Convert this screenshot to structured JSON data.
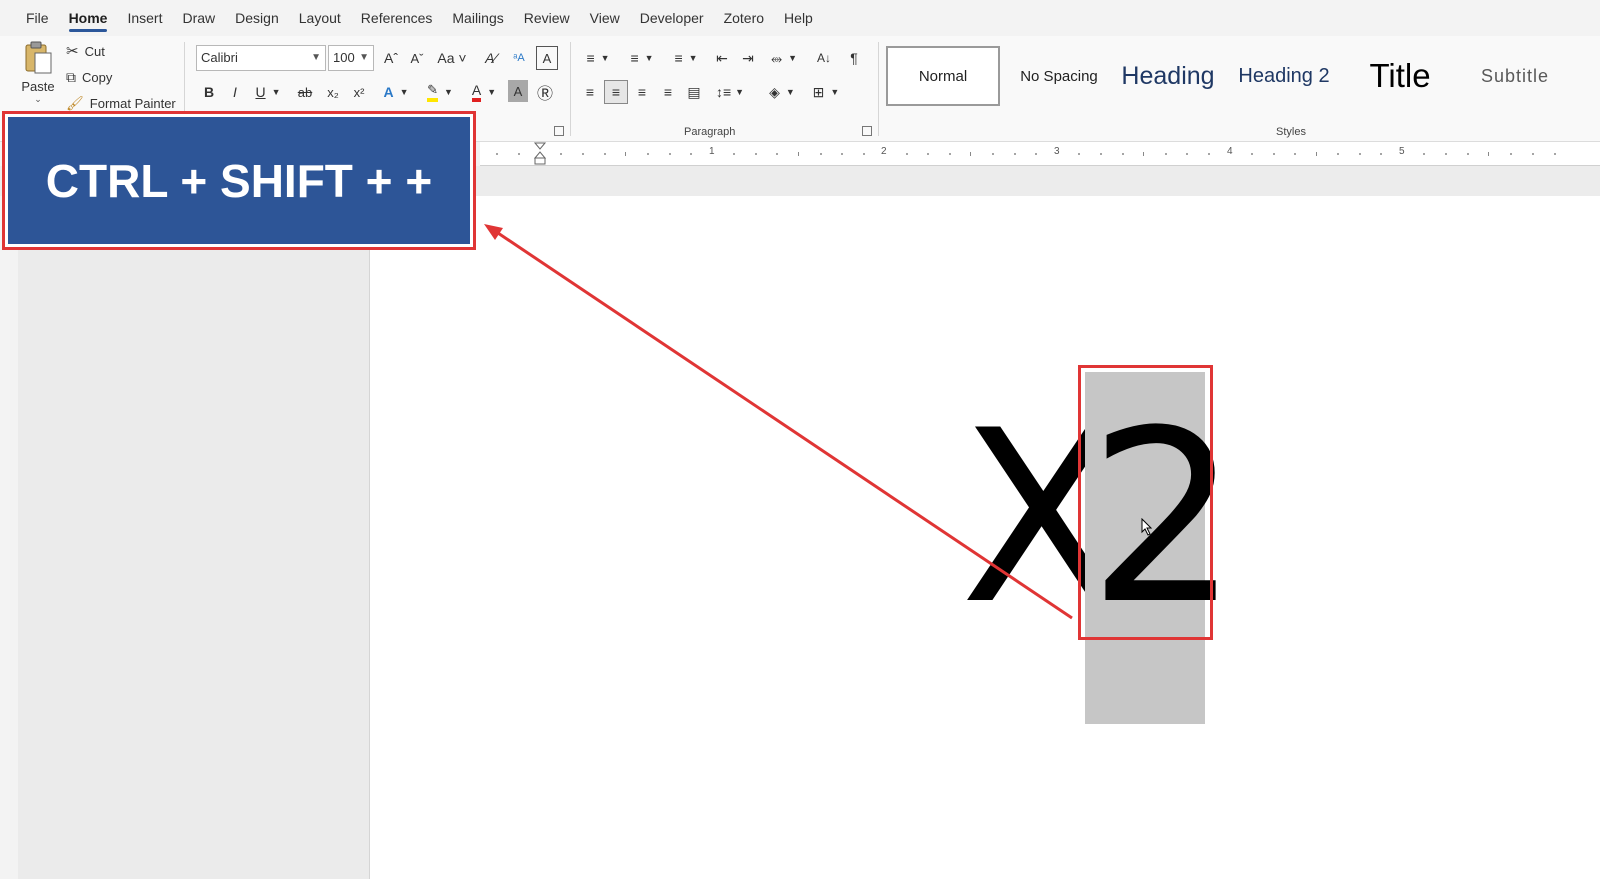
{
  "menu": {
    "tabs": [
      "File",
      "Home",
      "Insert",
      "Draw",
      "Design",
      "Layout",
      "References",
      "Mailings",
      "Review",
      "View",
      "Developer",
      "Zotero",
      "Help"
    ],
    "active": "Home"
  },
  "clipboard": {
    "paste_label": "Paste",
    "cut_label": "Cut",
    "copy_label": "Copy",
    "format_painter_label": "Format Painter"
  },
  "font": {
    "family": "Calibri",
    "size": "100"
  },
  "paragraph": {
    "group_label": "Paragraph"
  },
  "styles": {
    "group_label": "Styles",
    "items": [
      "Normal",
      "No Spacing",
      "Heading",
      "Heading 2",
      "Title",
      "Subtitle"
    ],
    "selected": "Normal"
  },
  "ruler": {
    "numbers": [
      "1",
      "2",
      "3",
      "4",
      "5"
    ]
  },
  "document": {
    "base": "X",
    "exponent": "2"
  },
  "shortcut": {
    "text": "CTRL + SHIFT + +"
  },
  "colors": {
    "banner": "#2d5597",
    "highlight_border": "#e03535",
    "selection": "#c6c6c6"
  }
}
